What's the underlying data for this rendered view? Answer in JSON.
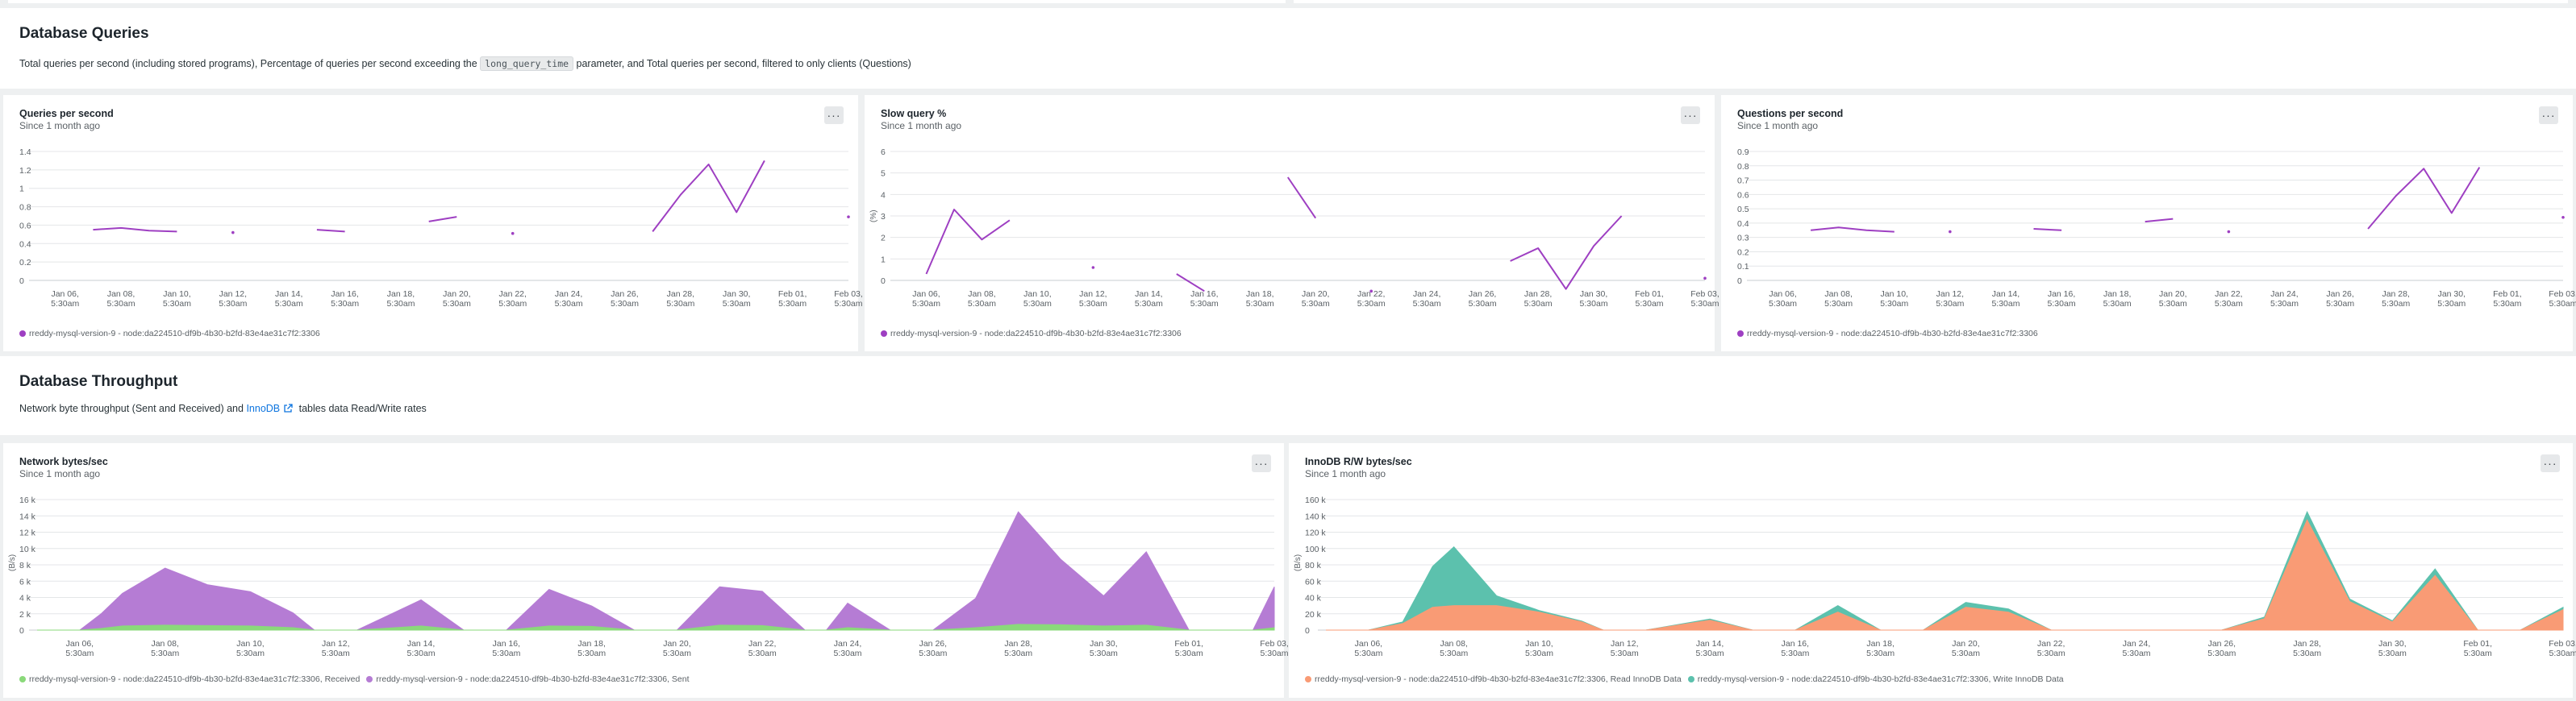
{
  "sections": {
    "queries": {
      "title": "Database Queries",
      "desc_before": "Total queries per second (including stored programs), Percentage of queries per second exceeding the",
      "desc_code": "long_query_time",
      "desc_after": "parameter, and Total queries per second, filtered to only clients (Questions)"
    },
    "throughput": {
      "title": "Database Throughput",
      "desc_before": "Network byte throughput (Sent and Received) and",
      "desc_link": "InnoDB",
      "desc_after": "tables data Read/Write rates"
    }
  },
  "menu_label": "···",
  "x_ticks": [
    "Jan 06,|5:30am",
    "Jan 08,|5:30am",
    "Jan 10,|5:30am",
    "Jan 12,|5:30am",
    "Jan 14,|5:30am",
    "Jan 16,|5:30am",
    "Jan 18,|5:30am",
    "Jan 20,|5:30am",
    "Jan 22,|5:30am",
    "Jan 24,|5:30am",
    "Jan 26,|5:30am",
    "Jan 28,|5:30am",
    "Jan 30,|5:30am",
    "Feb 01,|5:30am",
    "Feb 03,|5:30am"
  ],
  "chart_data": [
    {
      "id": "qps",
      "type": "line",
      "title": "Queries per second",
      "subtitle": "Since 1 month ago",
      "ylabel": "",
      "ylim": [
        0,
        1.4
      ],
      "yticks": [
        "0",
        "0.2",
        "0.4",
        "0.6",
        "0.8",
        "1",
        "1.2",
        "1.4"
      ],
      "grid": true,
      "legend_position": "bottom",
      "x_range": [
        5,
        34
      ],
      "color": "#9e3fc2",
      "series": [
        {
          "name": "rreddy-mysql-version-9 - node:da224510-df9b-4b30-b2fd-83e4ae31c7f2:3306",
          "segments": [
            [
              [
                7,
                0.55
              ],
              [
                8,
                0.57
              ],
              [
                9,
                0.54
              ],
              [
                10,
                0.53
              ]
            ],
            [
              [
                12,
                0.52
              ]
            ],
            [
              [
                15,
                0.55
              ],
              [
                16,
                0.53
              ]
            ],
            [
              [
                19,
                0.64
              ],
              [
                20,
                0.69
              ]
            ],
            [
              [
                22,
                0.51
              ]
            ],
            [
              [
                27,
                0.53
              ],
              [
                28,
                0.93
              ],
              [
                29,
                1.26
              ],
              [
                30,
                0.74
              ],
              [
                31,
                1.3
              ]
            ],
            [
              [
                34,
                0.69
              ]
            ]
          ]
        }
      ]
    },
    {
      "id": "slow",
      "type": "line",
      "title": "Slow query %",
      "subtitle": "Since 1 month ago",
      "ylabel": "(%)",
      "ylim": [
        0,
        6
      ],
      "yticks": [
        "0",
        "1",
        "2",
        "3",
        "4",
        "5",
        "6"
      ],
      "grid": true,
      "legend_position": "bottom",
      "x_range": [
        5,
        34
      ],
      "color": "#9e3fc2",
      "series": [
        {
          "name": "rreddy-mysql-version-9 - node:da224510-df9b-4b30-b2fd-83e4ae31c7f2:3306",
          "segments": [
            [
              [
                6,
                0.3
              ],
              [
                7,
                3.3
              ],
              [
                8,
                1.9
              ],
              [
                9,
                2.8
              ]
            ],
            [
              [
                12,
                0.6
              ]
            ],
            [
              [
                15,
                0.3
              ],
              [
                16,
                -0.5
              ]
            ],
            [
              [
                19,
                4.8
              ],
              [
                20,
                2.9
              ]
            ],
            [
              [
                22,
                -0.5
              ]
            ],
            [
              [
                27,
                0.9
              ],
              [
                28,
                1.5
              ],
              [
                29,
                -0.4
              ],
              [
                30,
                1.6
              ],
              [
                31,
                3.0
              ]
            ],
            [
              [
                34,
                0.1
              ]
            ]
          ]
        }
      ]
    },
    {
      "id": "questions",
      "type": "line",
      "title": "Questions per second",
      "subtitle": "Since 1 month ago",
      "ylabel": "",
      "ylim": [
        0,
        0.9
      ],
      "yticks": [
        "0",
        "0.1",
        "0.2",
        "0.3",
        "0.4",
        "0.5",
        "0.6",
        "0.7",
        "0.8",
        "0.9"
      ],
      "grid": true,
      "legend_position": "bottom",
      "x_range": [
        5,
        34
      ],
      "color": "#9e3fc2",
      "series": [
        {
          "name": "rreddy-mysql-version-9 - node:da224510-df9b-4b30-b2fd-83e4ae31c7f2:3306",
          "segments": [
            [
              [
                7,
                0.35
              ],
              [
                8,
                0.37
              ],
              [
                9,
                0.35
              ],
              [
                10,
                0.34
              ]
            ],
            [
              [
                12,
                0.34
              ]
            ],
            [
              [
                15,
                0.36
              ],
              [
                16,
                0.35
              ]
            ],
            [
              [
                19,
                0.41
              ],
              [
                20,
                0.43
              ]
            ],
            [
              [
                22,
                0.34
              ]
            ],
            [
              [
                27,
                0.36
              ],
              [
                28,
                0.59
              ],
              [
                29,
                0.78
              ],
              [
                30,
                0.47
              ],
              [
                31,
                0.79
              ]
            ],
            [
              [
                34,
                0.44
              ]
            ]
          ]
        }
      ]
    },
    {
      "id": "network",
      "type": "area",
      "title": "Network bytes/sec",
      "subtitle": "Since 1 month ago",
      "ylabel": "(B/s)",
      "ylim": [
        0,
        16000
      ],
      "yticks": [
        "0",
        "2 k",
        "4 k",
        "6 k",
        "8 k",
        "10 k",
        "12 k",
        "14 k",
        "16 k"
      ],
      "grid": true,
      "stacked": true,
      "legend_position": "bottom",
      "x_range": [
        5,
        34
      ],
      "series": [
        {
          "name": "rreddy-mysql-version-9 - node:da224510-df9b-4b30-b2fd-83e4ae31c7f2:3306, Received",
          "color": "#8ad97a",
          "points": [
            [
              5,
              0
            ],
            [
              6,
              0
            ],
            [
              6.5,
              200
            ],
            [
              7,
              500
            ],
            [
              8,
              600
            ],
            [
              9,
              550
            ],
            [
              10,
              500
            ],
            [
              11,
              300
            ],
            [
              11.5,
              0
            ],
            [
              12.5,
              0
            ],
            [
              14,
              500
            ],
            [
              15,
              0
            ],
            [
              16,
              0
            ],
            [
              17,
              500
            ],
            [
              18,
              450
            ],
            [
              19,
              0
            ],
            [
              20,
              0
            ],
            [
              21,
              600
            ],
            [
              22,
              550
            ],
            [
              23,
              0
            ],
            [
              23.5,
              0
            ],
            [
              24,
              300
            ],
            [
              25,
              0
            ],
            [
              26,
              0
            ],
            [
              27,
              300
            ],
            [
              28,
              700
            ],
            [
              29,
              650
            ],
            [
              30,
              500
            ],
            [
              31,
              600
            ],
            [
              32,
              0
            ],
            [
              33,
              0
            ],
            [
              33.5,
              0
            ],
            [
              34,
              300
            ]
          ]
        },
        {
          "name": "rreddy-mysql-version-9 - node:da224510-df9b-4b30-b2fd-83e4ae31c7f2:3306, Sent",
          "color": "#b57cd4",
          "points": [
            [
              5,
              0
            ],
            [
              6,
              0
            ],
            [
              6.5,
              1800
            ],
            [
              7,
              4000
            ],
            [
              8,
              7000
            ],
            [
              9,
              5000
            ],
            [
              10,
              4200
            ],
            [
              11,
              1800
            ],
            [
              11.5,
              0
            ],
            [
              12.5,
              0
            ],
            [
              14,
              3200
            ],
            [
              15,
              0
            ],
            [
              16,
              0
            ],
            [
              17,
              4500
            ],
            [
              18,
              2500
            ],
            [
              19,
              0
            ],
            [
              20,
              0
            ],
            [
              21,
              4700
            ],
            [
              22,
              4200
            ],
            [
              23,
              0
            ],
            [
              23.5,
              0
            ],
            [
              24,
              3000
            ],
            [
              25,
              0
            ],
            [
              26,
              0
            ],
            [
              27,
              3600
            ],
            [
              28,
              13800
            ],
            [
              29,
              8000
            ],
            [
              30,
              3700
            ],
            [
              31,
              9000
            ],
            [
              32,
              0
            ],
            [
              33,
              0
            ],
            [
              33.5,
              0
            ],
            [
              34,
              5000
            ]
          ]
        }
      ]
    },
    {
      "id": "innodb",
      "type": "area",
      "title": "InnoDB R/W bytes/sec",
      "subtitle": "Since 1 month ago",
      "ylabel": "(B/s)",
      "ylim": [
        0,
        160000
      ],
      "yticks": [
        "0",
        "20 k",
        "40 k",
        "60 k",
        "80 k",
        "100 k",
        "120 k",
        "140 k",
        "160 k"
      ],
      "grid": true,
      "stacked": true,
      "legend_position": "bottom",
      "x_range": [
        5,
        34
      ],
      "series": [
        {
          "name": "rreddy-mysql-version-9 - node:da224510-df9b-4b30-b2fd-83e4ae31c7f2:3306, Read InnoDB Data",
          "color": "#f99b75",
          "points": [
            [
              5,
              0
            ],
            [
              6,
              0
            ],
            [
              6.8,
              8000
            ],
            [
              7.5,
              28000
            ],
            [
              8,
              30000
            ],
            [
              9,
              30000
            ],
            [
              10,
              22000
            ],
            [
              11,
              10000
            ],
            [
              11.5,
              0
            ],
            [
              12.5,
              0
            ],
            [
              14,
              12000
            ],
            [
              15,
              0
            ],
            [
              16,
              0
            ],
            [
              17,
              22000
            ],
            [
              18,
              0
            ],
            [
              19,
              0
            ],
            [
              20,
              28000
            ],
            [
              21,
              22000
            ],
            [
              22,
              0
            ],
            [
              23,
              0
            ],
            [
              25,
              0
            ],
            [
              26,
              0
            ],
            [
              27,
              14000
            ],
            [
              28,
              135000
            ],
            [
              29,
              35000
            ],
            [
              30,
              10000
            ],
            [
              31,
              67000
            ],
            [
              32,
              0
            ],
            [
              33,
              0
            ],
            [
              34,
              25000
            ]
          ]
        },
        {
          "name": "rreddy-mysql-version-9 - node:da224510-df9b-4b30-b2fd-83e4ae31c7f2:3306, Write InnoDB Data",
          "color": "#5cc1ad",
          "points": [
            [
              5,
              0
            ],
            [
              6,
              0
            ],
            [
              6.8,
              2000
            ],
            [
              7.5,
              50000
            ],
            [
              8,
              72000
            ],
            [
              9,
              12000
            ],
            [
              10,
              2000
            ],
            [
              11,
              1000
            ],
            [
              11.5,
              0
            ],
            [
              12.5,
              0
            ],
            [
              14,
              1500
            ],
            [
              15,
              0
            ],
            [
              16,
              0
            ],
            [
              17,
              8000
            ],
            [
              18,
              0
            ],
            [
              19,
              0
            ],
            [
              20,
              6000
            ],
            [
              21,
              4000
            ],
            [
              22,
              0
            ],
            [
              23,
              0
            ],
            [
              25,
              0
            ],
            [
              26,
              0
            ],
            [
              27,
              2000
            ],
            [
              28,
              10000
            ],
            [
              29,
              3000
            ],
            [
              30,
              1500
            ],
            [
              31,
              8000
            ],
            [
              32,
              0
            ],
            [
              33,
              0
            ],
            [
              34,
              3000
            ]
          ]
        }
      ]
    }
  ]
}
